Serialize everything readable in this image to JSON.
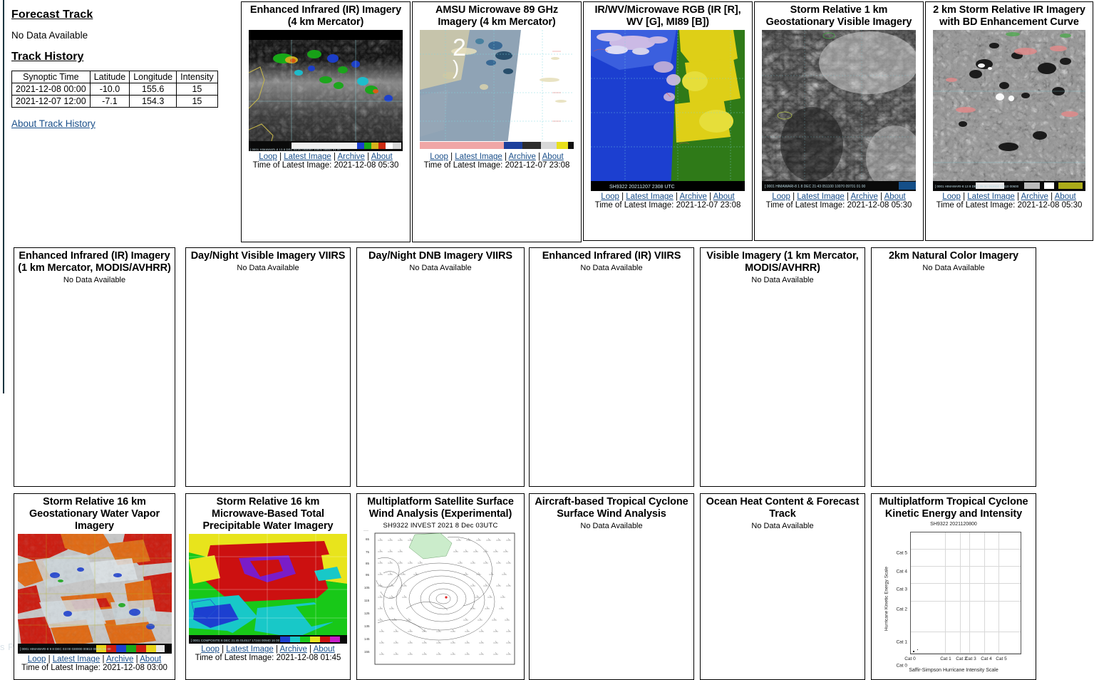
{
  "left_panel": {
    "forecast_track_heading": "Forecast Track",
    "forecast_track_status": "No Data Available",
    "track_history_heading": "Track History",
    "table": {
      "headers": [
        "Synoptic Time",
        "Latitude",
        "Longitude",
        "Intensity"
      ],
      "rows": [
        [
          "2021-12-08 00:00",
          "-10.0",
          "155.6",
          "15"
        ],
        [
          "2021-12-07 12:00",
          "-7.1",
          "154.3",
          "15"
        ]
      ]
    },
    "about_link": "About Track History"
  },
  "link_labels": {
    "loop": "Loop",
    "latest_image": "Latest Image",
    "archive": "Archive",
    "about": "About",
    "separator": "|"
  },
  "panels": {
    "ir_4km": {
      "title": "Enhanced Infrared (IR) Imagery (4 km Mercator)",
      "timestamp": "Time of Latest Image: 2021-12-08 05:30",
      "embedded_text": "[ 0001  HIMAWARI-8  13    8 DEC 05:30  053000 10001  00641 01 00"
    },
    "amsu_89": {
      "title": "AMSU Microwave 89 GHz Imagery (4 km Mercator)",
      "timestamp": "Time of Latest Image: 2021-12-07 23:08"
    },
    "rgb": {
      "title": "IR/WV/Microwave RGB (IR [R], WV [G], MI89 [B])",
      "timestamp": "Time of Latest Image: 2021-12-07 23:08",
      "embedded_text": "SH9322  20211207  2308  UTC"
    },
    "sr_vis_1km": {
      "title": "Storm Relative 1 km Geostationary Visible Imagery",
      "timestamp": "Time of Latest Image: 2021-12-08 05:30",
      "embedded_text": "[ 0001  HIMAWARI-8   1    8 DEC 21:43  051100 10070 09701 01 00"
    },
    "sr_ir_2km": {
      "title": "2 km Storm Relative IR Imagery with BD Enhancement Curve",
      "timestamp": "Time of Latest Image: 2021-12-08 05:30",
      "embedded_text": "[ 0001  HIMAWARI-8  13    8 DEC 05:30  053000 10110  00600"
    },
    "ir_1km_modis": {
      "title": "Enhanced Infrared (IR) Imagery (1 km Mercator, MODIS/AVHRR)",
      "status": "No Data Available"
    },
    "dn_vis_viirs": {
      "title": "Day/Night Visible Imagery VIIRS",
      "status": "No Data Available"
    },
    "dn_dnb_viirs": {
      "title": "Day/Night DNB Imagery VIIRS",
      "status": "No Data Available"
    },
    "ir_viirs": {
      "title": "Enhanced Infrared (IR) VIIRS",
      "status": "No Data Available"
    },
    "vis_1km_modis": {
      "title": "Visible Imagery (1 km Mercator, MODIS/AVHRR)",
      "status": "No Data Available"
    },
    "natural_color_2km": {
      "title": "2km Natural Color Imagery",
      "status": "No Data Available"
    },
    "sr_wv_16km": {
      "title": "Storm Relative 16 km Geostationary Water Vapor Imagery",
      "timestamp": "Time of Latest Image: 2021-12-08 03:00",
      "embedded_text": "[ 0001  HIMAWARI-8   9    8 DEC 03:00  030000 00810  00631 01 00"
    },
    "sr_tpw_16km": {
      "title": "Storm Relative 16 km Microwave-Based Total Precipitable Water Imagery",
      "timestamp": "Time of Latest Image: 2021-12-08 01:45",
      "embedded_text": "[ 0001  COMPOSITE        8 DEC 21:45  014517 17244 00940 16 00"
    },
    "mtcswa": {
      "title": "Multiplatform Satellite Surface Wind Analysis (Experimental)",
      "subtitle": "SH9322     INVEST     2021    8 Dec  03UTC"
    },
    "aircraft_wind": {
      "title": "Aircraft-based Tropical Cyclone Surface Wind Analysis",
      "status": "No Data Available"
    },
    "ohc": {
      "title": "Ocean Heat Content & Forecast Track",
      "status": "No Data Available"
    },
    "kinetic": {
      "title": "Multiplatform Tropical Cyclone Kinetic Energy and Intensity"
    }
  },
  "chart_data": {
    "type": "scatter",
    "title": "Multiplatform Tropical Cyclone Kinetic Energy and Intensity",
    "subtitle": "SH9322 2021120800",
    "xlabel": "Saffir-Simpson Hurricane Intensity Scale",
    "ylabel": "Hurricane Kinetic Energy Scale",
    "xticks": [
      "Cat 0",
      "Cat 1",
      "Cat 2",
      "Cat 3",
      "Cat 4",
      "Cat 5"
    ],
    "xtick_positions": [
      0,
      31,
      45,
      53,
      67,
      80
    ],
    "yticks": [
      "Cat 0",
      "Cat 1",
      "Cat 2",
      "Cat 3",
      "Cat 4",
      "Cat 5"
    ],
    "ytick_positions": [
      0,
      18,
      43,
      58,
      72,
      86
    ],
    "points": [
      [
        0.5,
        0.6
      ],
      [
        2.0,
        1.4
      ]
    ],
    "grid": true,
    "legend": "none"
  },
  "misc": {
    "watermark": "s Pie..."
  }
}
